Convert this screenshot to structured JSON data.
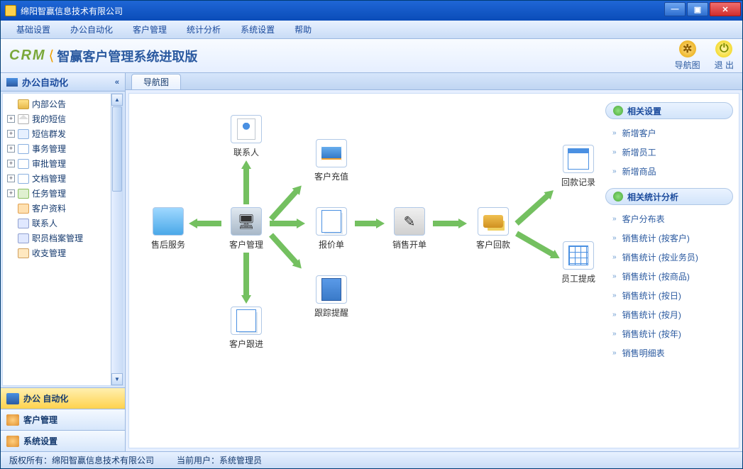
{
  "window": {
    "title": "绵阳智赢信息技术有限公司"
  },
  "win_buttons": {
    "min": "—",
    "max": "▣",
    "close": "✕"
  },
  "menu": [
    "基础设置",
    "办公自动化",
    "客户管理",
    "统计分析",
    "系统设置",
    "帮助"
  ],
  "product": {
    "brand": "CRM",
    "name": "智赢客户管理系统进取版"
  },
  "toolbar": {
    "nav": "导航图",
    "exit": "退 出"
  },
  "sidebar": {
    "header": "办公自动化",
    "tree": [
      {
        "exp": "",
        "icon": "folder",
        "label": "内部公告"
      },
      {
        "exp": "+",
        "icon": "mail",
        "label": "我的短信"
      },
      {
        "exp": "+",
        "icon": "msg",
        "label": "短信群发"
      },
      {
        "exp": "+",
        "icon": "doc",
        "label": "事务管理"
      },
      {
        "exp": "+",
        "icon": "doc",
        "label": "审批管理"
      },
      {
        "exp": "+",
        "icon": "doc",
        "label": "文档管理"
      },
      {
        "exp": "+",
        "icon": "task",
        "label": "任务管理"
      },
      {
        "exp": "",
        "icon": "person",
        "label": "客户资料"
      },
      {
        "exp": "",
        "icon": "card",
        "label": "联系人"
      },
      {
        "exp": "",
        "icon": "card",
        "label": "职员档案管理"
      },
      {
        "exp": "",
        "icon": "money",
        "label": "收支管理"
      }
    ],
    "sections": [
      {
        "key": "auto",
        "label": "办公 自动化",
        "active": true
      },
      {
        "key": "cust",
        "label": "客户管理",
        "active": false
      },
      {
        "key": "sys",
        "label": "系统设置",
        "active": false
      }
    ]
  },
  "tab": {
    "label": "导航图"
  },
  "flow": {
    "after_sale": "售后服务",
    "cust_mgmt": "客户管理",
    "contact": "联系人",
    "recharge": "客户充值",
    "quote": "报价单",
    "sales": "销售开单",
    "payment": "客户回款",
    "followup": "客户跟进",
    "reminder": "跟踪提醒",
    "pay_record": "回款记录",
    "emp_comm": "员工提成"
  },
  "right": {
    "settings_header": "相关设置",
    "settings": [
      "新增客户",
      "新增员工",
      "新增商品"
    ],
    "stats_header": "相关统计分析",
    "stats": [
      "客户分布表",
      "销售统计 (按客户)",
      "销售统计 (按业务员)",
      "销售统计 (按商品)",
      "销售统计 (按日)",
      "销售统计 (按月)",
      "销售统计 (按年)",
      "销售明细表"
    ]
  },
  "status": {
    "copyright": "版权所有：绵阳智赢信息技术有限公司",
    "user": "当前用户：系统管理员"
  }
}
